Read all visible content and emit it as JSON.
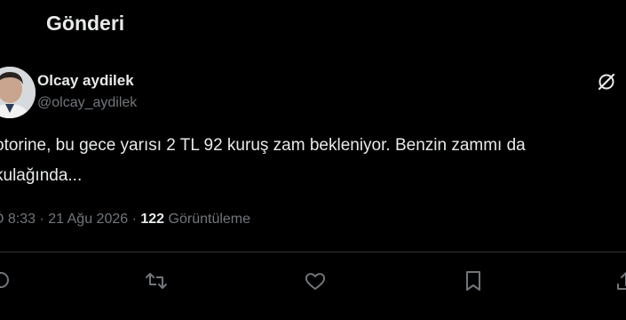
{
  "header": {
    "title": "Gönderi"
  },
  "author": {
    "name": "Olcay aydilek",
    "handle": "@olcay_aydilek"
  },
  "tweet": {
    "line1": "otorine, bu gece yarısı 2 TL 92 kuruş zam bekleniyor. Benzin zammı da",
    "line2": "kulağında..."
  },
  "meta": {
    "time": "Ö 8:33",
    "date": "21 Ağu 2026",
    "views_count": "122",
    "views_label": "Görüntüleme"
  },
  "icons": {
    "grok": "grok-icon",
    "reply": "reply-icon",
    "retweet": "retweet-icon",
    "like": "heart-icon",
    "bookmark": "bookmark-icon",
    "share": "share-icon"
  },
  "colors": {
    "background": "#000000",
    "text": "#e7e9ea",
    "secondary": "#71767b",
    "divider": "#2f3336"
  }
}
